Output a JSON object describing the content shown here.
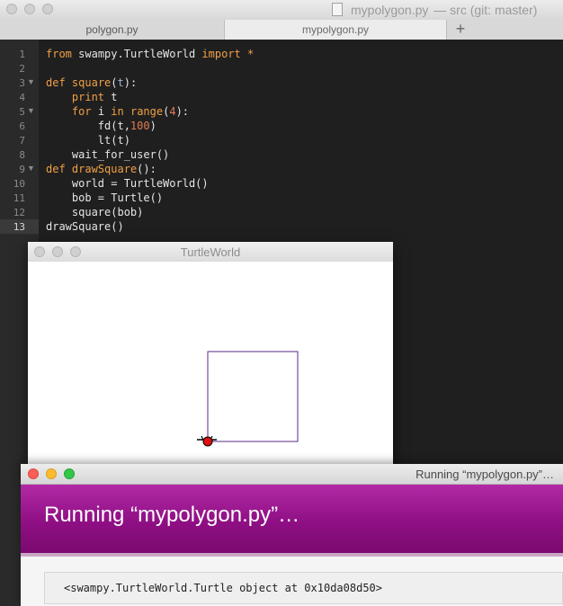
{
  "editor": {
    "window_title_file": "mypolygon.py",
    "window_title_rest": "— src (git: master)",
    "tabs": [
      {
        "label": "polygon.py",
        "active": false
      },
      {
        "label": "mypolygon.py",
        "active": true
      }
    ],
    "add_tab_label": "+",
    "line_numbers": [
      "1",
      "2",
      "3",
      "4",
      "5",
      "6",
      "7",
      "8",
      "9",
      "10",
      "11",
      "12",
      "13"
    ],
    "current_line": "13",
    "fold_markers": [
      "▼",
      "▼",
      "▼"
    ],
    "code": {
      "l1_from": "from",
      "l1_mod": "swampy.TurtleWorld",
      "l1_import": "import",
      "l1_star": "*",
      "l3_def": "def",
      "l3_name": "square",
      "l3_open": "(",
      "l3_param": "t",
      "l3_close": "):",
      "l4_print": "print",
      "l4_arg": "t",
      "l5_for": "for",
      "l5_var": "i",
      "l5_in": "in",
      "l5_range": "range",
      "l5_open": "(",
      "l5_num": "4",
      "l5_close": "):",
      "l6_call": "fd(t,",
      "l6_num": "100",
      "l6_close": ")",
      "l7": "lt(t)",
      "l8": "wait_for_user()",
      "l9_def": "def",
      "l9_name": "drawSquare",
      "l9_close": "():",
      "l10": "world = TurtleWorld()",
      "l11": "bob = Turtle()",
      "l12": "square(bob)",
      "l13": "drawSquare()"
    }
  },
  "turtleworld": {
    "title": "TurtleWorld",
    "square_color": "#5b2a86",
    "turtle_color": "#e01010"
  },
  "running": {
    "title": "Running “mypolygon.py”…",
    "banner": "Running “mypolygon.py”…",
    "output": "<swampy.TurtleWorld.Turtle object at 0x10da08d50>",
    "colors": {
      "close": "#fc5f57",
      "minimize": "#fdbc2e",
      "zoom": "#33c748",
      "banner": "#9b1590"
    }
  }
}
